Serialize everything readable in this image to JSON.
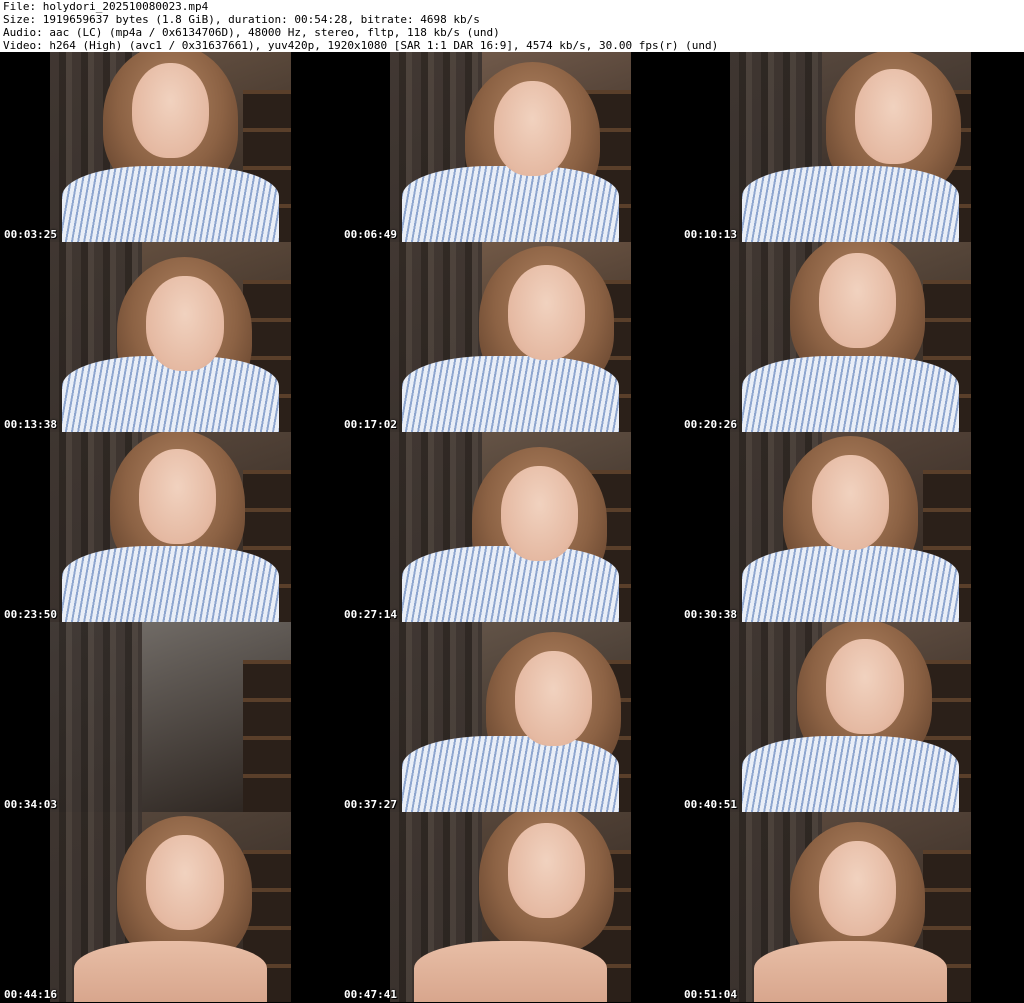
{
  "header": {
    "lines": [
      "File: holydori_202510080023.mp4",
      "Size: 1919659637 bytes (1.8 GiB), duration: 00:54:28, bitrate: 4698 kb/s",
      "Audio: aac (LC) (mp4a / 0x6134706D), 48000 Hz, stereo, fltp, 118 kb/s (und)",
      "Video: h264 (High) (avc1 / 0x31637661), yuv420p, 1920x1080 [SAR 1:1 DAR 16:9], 4574 kb/s, 30.00 fps(r) (und)"
    ]
  },
  "colors": {
    "background": "#000000",
    "header_bg": "#ffffff",
    "timestamp": "#ffffff"
  },
  "thumbnails": [
    {
      "time": "00:03:25",
      "tone": "#6e5847",
      "shirt": true
    },
    {
      "time": "00:06:49",
      "tone": "#7a6150",
      "shirt": true
    },
    {
      "time": "00:10:13",
      "tone": "#5c4c41",
      "shirt": true
    },
    {
      "time": "00:13:38",
      "tone": "#6a5443",
      "shirt": true
    },
    {
      "time": "00:17:02",
      "tone": "#7b604c",
      "shirt": true
    },
    {
      "time": "00:20:26",
      "tone": "#6a5646",
      "shirt": true
    },
    {
      "time": "00:23:50",
      "tone": "#5f4d40",
      "shirt": true
    },
    {
      "time": "00:27:14",
      "tone": "#6d5a4b",
      "shirt": true
    },
    {
      "time": "00:30:38",
      "tone": "#5e4b3f",
      "shirt": true
    },
    {
      "time": "00:34:03",
      "tone": "#7a7570",
      "shirt": false,
      "empty": true
    },
    {
      "time": "00:37:27",
      "tone": "#6a5a4d",
      "shirt": true
    },
    {
      "time": "00:40:51",
      "tone": "#6b5749",
      "shirt": true
    },
    {
      "time": "00:44:16",
      "tone": "#5a4a3e",
      "shirt": false
    },
    {
      "time": "00:47:41",
      "tone": "#5c4a3d",
      "shirt": false
    },
    {
      "time": "00:51:04",
      "tone": "#604d40",
      "shirt": false
    }
  ]
}
